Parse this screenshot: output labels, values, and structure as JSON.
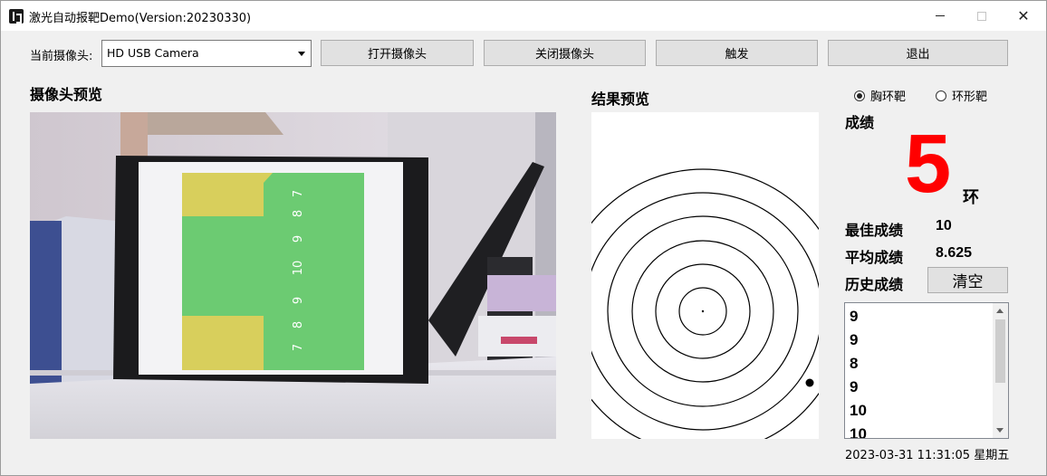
{
  "window": {
    "title": "激光自动报靶Demo(Version:20230330)",
    "minimize": "minimize",
    "maximize": "maximize",
    "close": "✕"
  },
  "toolbar": {
    "camera_label": "当前摄像头:",
    "camera_selected": "HD USB Camera",
    "open_camera": "打开摄像头",
    "close_camera": "关闭摄像头",
    "trigger": "触发",
    "exit": "退出"
  },
  "camera_preview": {
    "title": "摄像头预览",
    "target_numbers": [
      "7",
      "8",
      "9",
      "10",
      "9",
      "8",
      "7"
    ],
    "colors": {
      "target_yellow": "#d8cf5c",
      "target_green": "#6ccb72"
    }
  },
  "result_preview": {
    "title": "结果预览",
    "ring_count": 6,
    "hit": {
      "ring_score": 5
    }
  },
  "target_type": {
    "options": [
      {
        "label": "胸环靶",
        "checked": true
      },
      {
        "label": "环形靶",
        "checked": false
      }
    ]
  },
  "score": {
    "label": "成绩",
    "value": "5",
    "unit": "环",
    "color": "#ff0000"
  },
  "stats": {
    "best_label": "最佳成绩",
    "best_value": "10",
    "avg_label": "平均成绩",
    "avg_value": "8.625",
    "history_label": "历史成绩",
    "clear_button": "清空"
  },
  "history": [
    "9",
    "9",
    "8",
    "9",
    "10",
    "10"
  ],
  "datetime": "2023-03-31 11:31:05 星期五"
}
